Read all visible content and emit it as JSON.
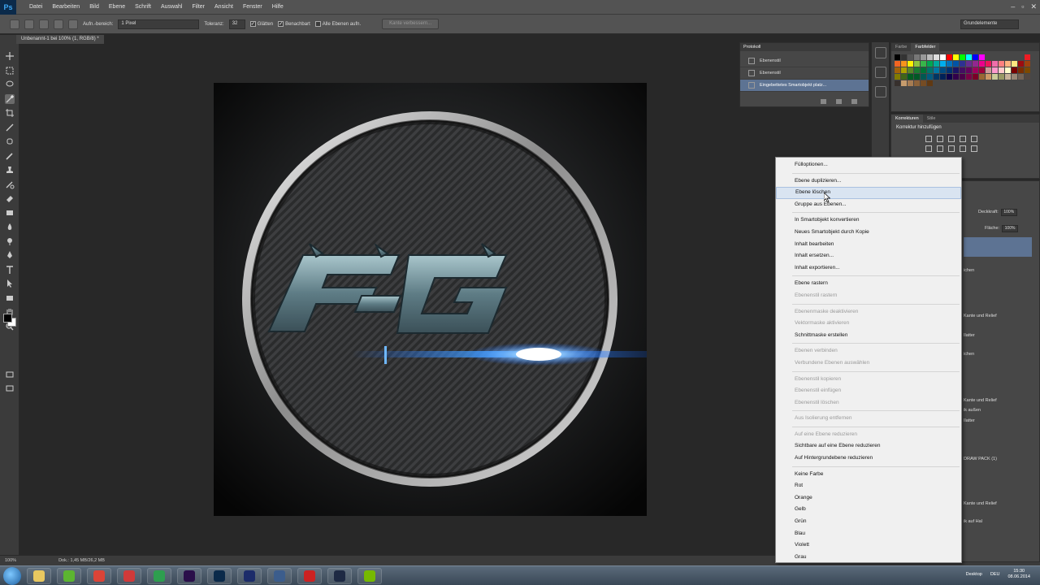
{
  "app": {
    "logo": "Ps"
  },
  "menu": [
    "Datei",
    "Bearbeiten",
    "Bild",
    "Ebene",
    "Schrift",
    "Auswahl",
    "Filter",
    "Ansicht",
    "Fenster",
    "Hilfe"
  ],
  "options": {
    "sample_label": "Aufn.-bereich:",
    "sample_value": "1 Pixel",
    "tolerance_label": "Toleranz:",
    "tolerance_value": "32",
    "smooth_label": "Glätten",
    "contiguous_label": "Benachbart",
    "all_layers_label": "Alle Ebenen aufn.",
    "refine_button": "Kante verbessern...",
    "workspace": "Grundelemente"
  },
  "document": {
    "tab_title": "Unbenannt-1 bei 100% (1, RGB/8) *"
  },
  "status": {
    "zoom": "100%",
    "doc_info": "Dok.: 1,45 MB/26,2 MB"
  },
  "history_panel": {
    "title": "Protokoll",
    "rows": [
      {
        "label": "Ebenenstil",
        "selected": false
      },
      {
        "label": "Ebenenstil",
        "selected": false
      },
      {
        "label": "Eingebettetes Smartobjekt platz...",
        "selected": true
      }
    ]
  },
  "swatches_panel": {
    "tabs": [
      "Farbe",
      "Farbfelder"
    ],
    "active_tab": 1
  },
  "adjust_panel": {
    "tabs": [
      "Korrekturen",
      "Stile"
    ],
    "title": "Korrektur hinzufügen"
  },
  "layers_panel": {
    "opacity_label": "Deckkraft:",
    "opacity_value": "100%",
    "fill_label": "Fläche:",
    "fill_value": "100%",
    "partial_lines": [
      "ichen",
      "Kante und Relief",
      "Ilatter",
      "ichen",
      "Kante und Relief",
      "ik außen",
      "Ilatter",
      "DRAW PACK (1)",
      "Kante und Relief",
      "ik auf Hal"
    ]
  },
  "context_menu": {
    "groups": [
      [
        {
          "label": "Fülloptionen...",
          "enabled": true
        }
      ],
      [
        {
          "label": "Ebene duplizieren...",
          "enabled": true
        },
        {
          "label": "Ebene löschen",
          "enabled": true,
          "hover": true
        },
        {
          "label": "Gruppe aus Ebenen...",
          "enabled": true
        }
      ],
      [
        {
          "label": "In Smartobjekt konvertieren",
          "enabled": true
        },
        {
          "label": "Neues Smartobjekt durch Kopie",
          "enabled": true
        },
        {
          "label": "Inhalt bearbeiten",
          "enabled": true
        },
        {
          "label": "Inhalt ersetzen...",
          "enabled": true
        },
        {
          "label": "Inhalt exportieren...",
          "enabled": true
        }
      ],
      [
        {
          "label": "Ebene rastern",
          "enabled": true
        },
        {
          "label": "Ebenenstil rastern",
          "enabled": false
        }
      ],
      [
        {
          "label": "Ebenenmaske deaktivieren",
          "enabled": false
        },
        {
          "label": "Vektormaske aktivieren",
          "enabled": false
        },
        {
          "label": "Schnittmaske erstellen",
          "enabled": true
        }
      ],
      [
        {
          "label": "Ebenen verbinden",
          "enabled": false
        },
        {
          "label": "Verbundene Ebenen auswählen",
          "enabled": false
        }
      ],
      [
        {
          "label": "Ebenenstil kopieren",
          "enabled": false
        },
        {
          "label": "Ebenenstil einfügen",
          "enabled": false
        },
        {
          "label": "Ebenenstil löschen",
          "enabled": false
        }
      ],
      [
        {
          "label": "Aus Isolierung entfernen",
          "enabled": false
        }
      ],
      [
        {
          "label": "Auf eine Ebene reduzieren",
          "enabled": false
        },
        {
          "label": "Sichtbare auf eine Ebene reduzieren",
          "enabled": true
        },
        {
          "label": "Auf Hintergrundebene reduzieren",
          "enabled": true
        }
      ],
      [
        {
          "label": "Keine Farbe",
          "enabled": true
        },
        {
          "label": "Rot",
          "enabled": true
        },
        {
          "label": "Orange",
          "enabled": true
        },
        {
          "label": "Gelb",
          "enabled": true
        },
        {
          "label": "Grün",
          "enabled": true
        },
        {
          "label": "Blau",
          "enabled": true
        },
        {
          "label": "Violett",
          "enabled": true
        },
        {
          "label": "Grau",
          "enabled": true
        }
      ]
    ]
  },
  "taskbar": {
    "icons": [
      {
        "name": "explorer-taskbar-icon",
        "color": "#e8c860"
      },
      {
        "name": "spotify-taskbar-icon",
        "color": "#5cb531"
      },
      {
        "name": "chrome-taskbar-icon",
        "color": "#db4437"
      },
      {
        "name": "skype-taskbar-icon",
        "color": "#d03a3a"
      },
      {
        "name": "app-green-taskbar-icon",
        "color": "#2e9e4f"
      },
      {
        "name": "after-effects-taskbar-icon",
        "color": "#2a0f4a"
      },
      {
        "name": "photoshop-taskbar-icon",
        "color": "#0b2a4a"
      },
      {
        "name": "app-blue-taskbar-icon",
        "color": "#1c2c6a"
      },
      {
        "name": "teamspeak-taskbar-icon",
        "color": "#3c5d8c"
      },
      {
        "name": "app-red-taskbar-icon",
        "color": "#cc2222"
      },
      {
        "name": "league-taskbar-icon",
        "color": "#1e2a44"
      },
      {
        "name": "nvidia-taskbar-icon",
        "color": "#76b900"
      }
    ],
    "tray_label": "Desktop",
    "lang": "DEU",
    "time": "15:30",
    "date": "08.06.2014"
  }
}
